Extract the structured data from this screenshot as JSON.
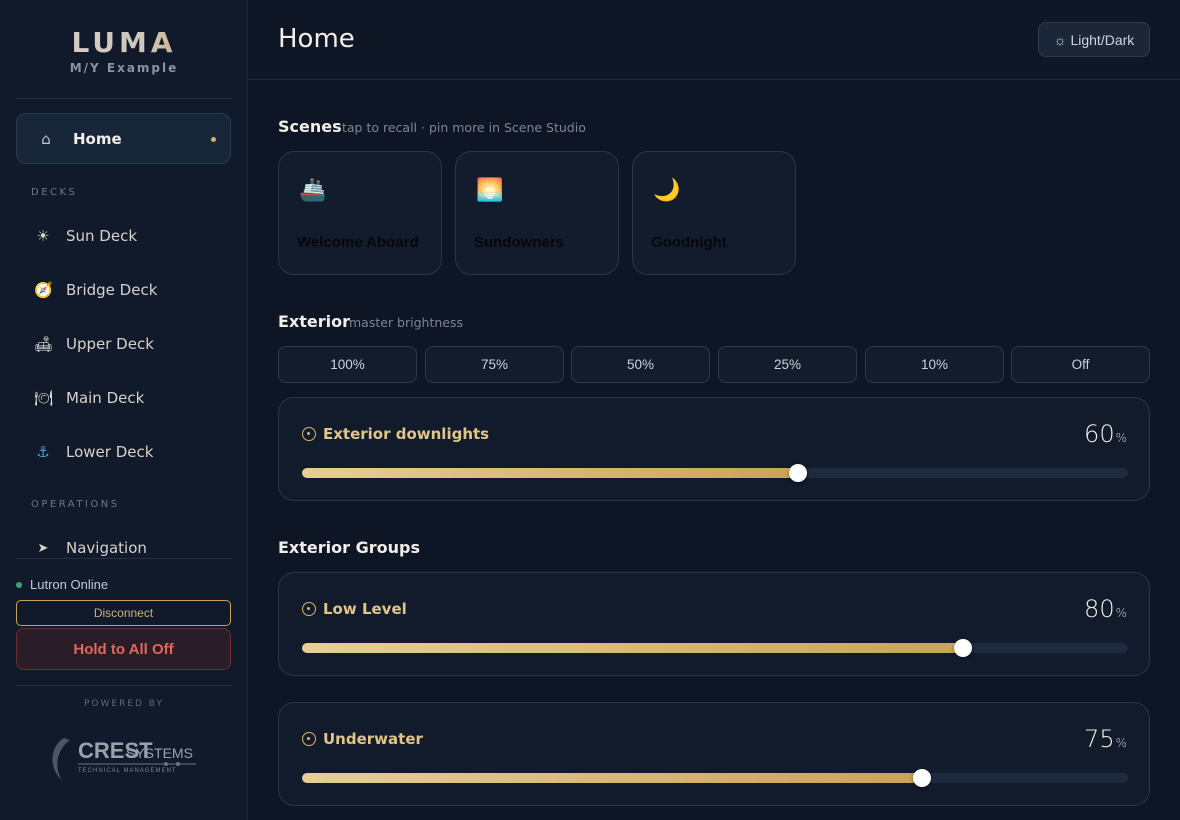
{
  "brand": {
    "logo": "LUMA",
    "vessel": "M/Y Example"
  },
  "sidebar": {
    "home": {
      "label": "Home",
      "icon": "home-icon"
    },
    "decks_label": "DECKS",
    "decks": [
      {
        "label": "Sun Deck",
        "icon": "sun-icon",
        "glyph": "☀"
      },
      {
        "label": "Bridge Deck",
        "icon": "compass-icon",
        "glyph": "🧭"
      },
      {
        "label": "Upper Deck",
        "icon": "sofa-icon",
        "glyph": "🛋"
      },
      {
        "label": "Main Deck",
        "icon": "dining-icon",
        "glyph": "🍽"
      },
      {
        "label": "Lower Deck",
        "icon": "anchor-icon",
        "glyph": "⚓"
      }
    ],
    "operations_label": "OPERATIONS",
    "operations": [
      {
        "label": "Navigation",
        "icon": "navigation-icon",
        "glyph": "➤"
      }
    ],
    "status": {
      "text": "Lutron Online",
      "color": "#3fa37a"
    },
    "disconnect_label": "Disconnect",
    "alloff_label": "Hold to All Off",
    "powered_by": "POWERED BY",
    "partner": {
      "name": "CREST",
      "suffix": "SYSTEMS",
      "tagline": "TECHNICAL MANAGEMENT"
    }
  },
  "header": {
    "title": "Home",
    "theme_toggle": "☼ Light/Dark"
  },
  "scenes": {
    "title": "Scenes",
    "subtitle": "tap to recall · pin more in Scene Studio",
    "items": [
      {
        "label": "Welcome Aboard",
        "icon": "ship-icon",
        "glyph": "🚢"
      },
      {
        "label": "Sundowners",
        "icon": "sunset-icon",
        "glyph": "🌅"
      },
      {
        "label": "Goodnight",
        "icon": "moon-icon",
        "glyph": "🌙"
      }
    ]
  },
  "exterior": {
    "title": "Exterior",
    "subtitle": "master brightness",
    "presets": [
      "100%",
      "75%",
      "50%",
      "25%",
      "10%",
      "Off"
    ],
    "master": {
      "name": "Exterior downlights",
      "value": "60",
      "unit": "%",
      "level": 0.6
    }
  },
  "groups": {
    "title": "Exterior Groups",
    "items": [
      {
        "name": "Low Level",
        "value": "80",
        "unit": "%",
        "level": 0.8
      },
      {
        "name": "Underwater",
        "value": "75",
        "unit": "%",
        "level": 0.75
      }
    ]
  },
  "colors": {
    "accent": "#d4b06a",
    "danger": "#e0675d",
    "background": "#0e1524"
  }
}
